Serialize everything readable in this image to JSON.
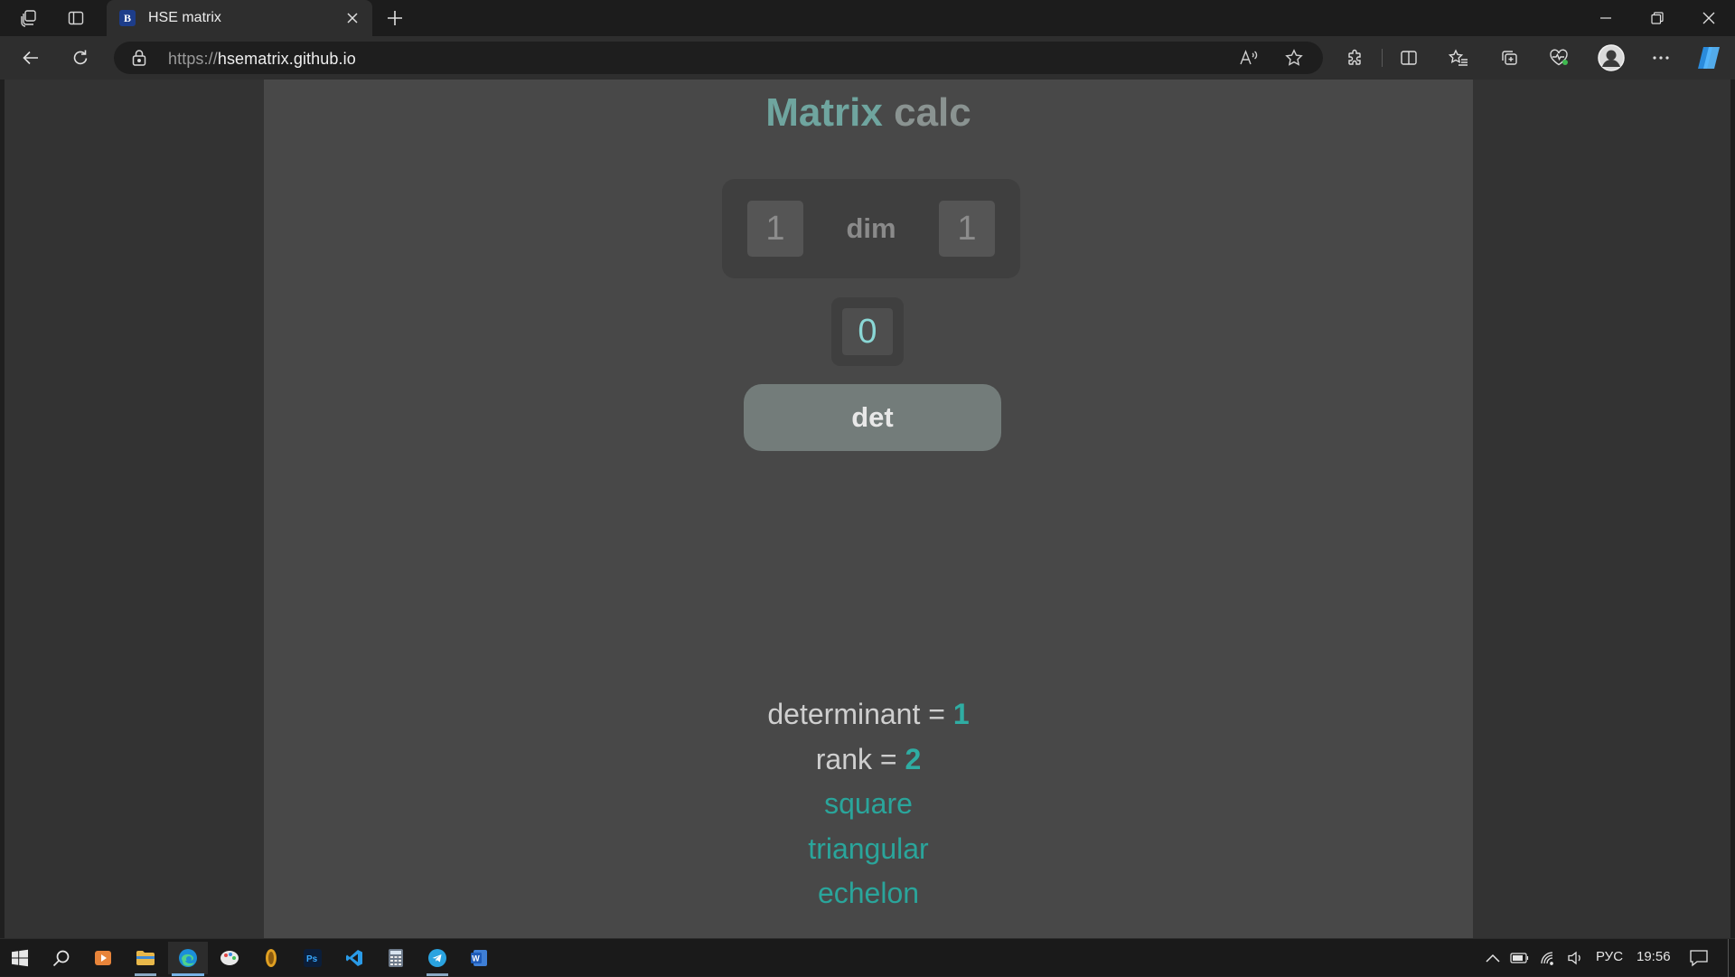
{
  "browser": {
    "tab_title": "HSE matrix",
    "tab_favicon_letter": "В",
    "url_scheme": "https://",
    "url_host": "hsematrix.github.io",
    "icons": {
      "workspaces": "workspaces-icon",
      "tab_actions": "tab-actions-icon",
      "close_tab": "close-icon",
      "new_tab": "plus-icon",
      "minimize": "minimize-icon",
      "restore": "restore-icon",
      "close_window": "close-icon",
      "back": "back-arrow-icon",
      "refresh": "refresh-icon",
      "lock": "lock-icon",
      "read_aloud": "read-aloud-icon",
      "favorite": "star-icon",
      "extensions": "puzzle-icon",
      "split_screen": "split-screen-icon",
      "favorites": "favorites-icon",
      "collections": "collections-icon",
      "browser_essentials": "heart-pulse-icon",
      "profile": "avatar",
      "menu": "more-icon",
      "copilot": "copilot-icon"
    }
  },
  "app": {
    "title_accent": "Matrix",
    "title_rest": "calc",
    "dim_rows": "1",
    "dim_label": "dim",
    "dim_cols": "1",
    "cell_value": "0",
    "det_button": "det",
    "results": {
      "determinant_label": "determinant =",
      "determinant_value": "1",
      "rank_label": "rank =",
      "rank_value": "2",
      "tags": [
        "square",
        "triangular",
        "echelon"
      ]
    },
    "colors": {
      "accent": "#6fa59f",
      "result_value": "#2fada3",
      "cell_text": "#8ad7d5",
      "button": "#737c7a"
    }
  },
  "taskbar": {
    "language": "РУС",
    "time": "19:56",
    "apps": [
      "start-icon",
      "search-icon",
      "media-player-icon",
      "file-explorer-icon",
      "edge-icon",
      "paint-icon",
      "app-icon",
      "photoshop-icon",
      "vscode-icon",
      "calculator-icon",
      "telegram-icon",
      "word-icon"
    ]
  }
}
